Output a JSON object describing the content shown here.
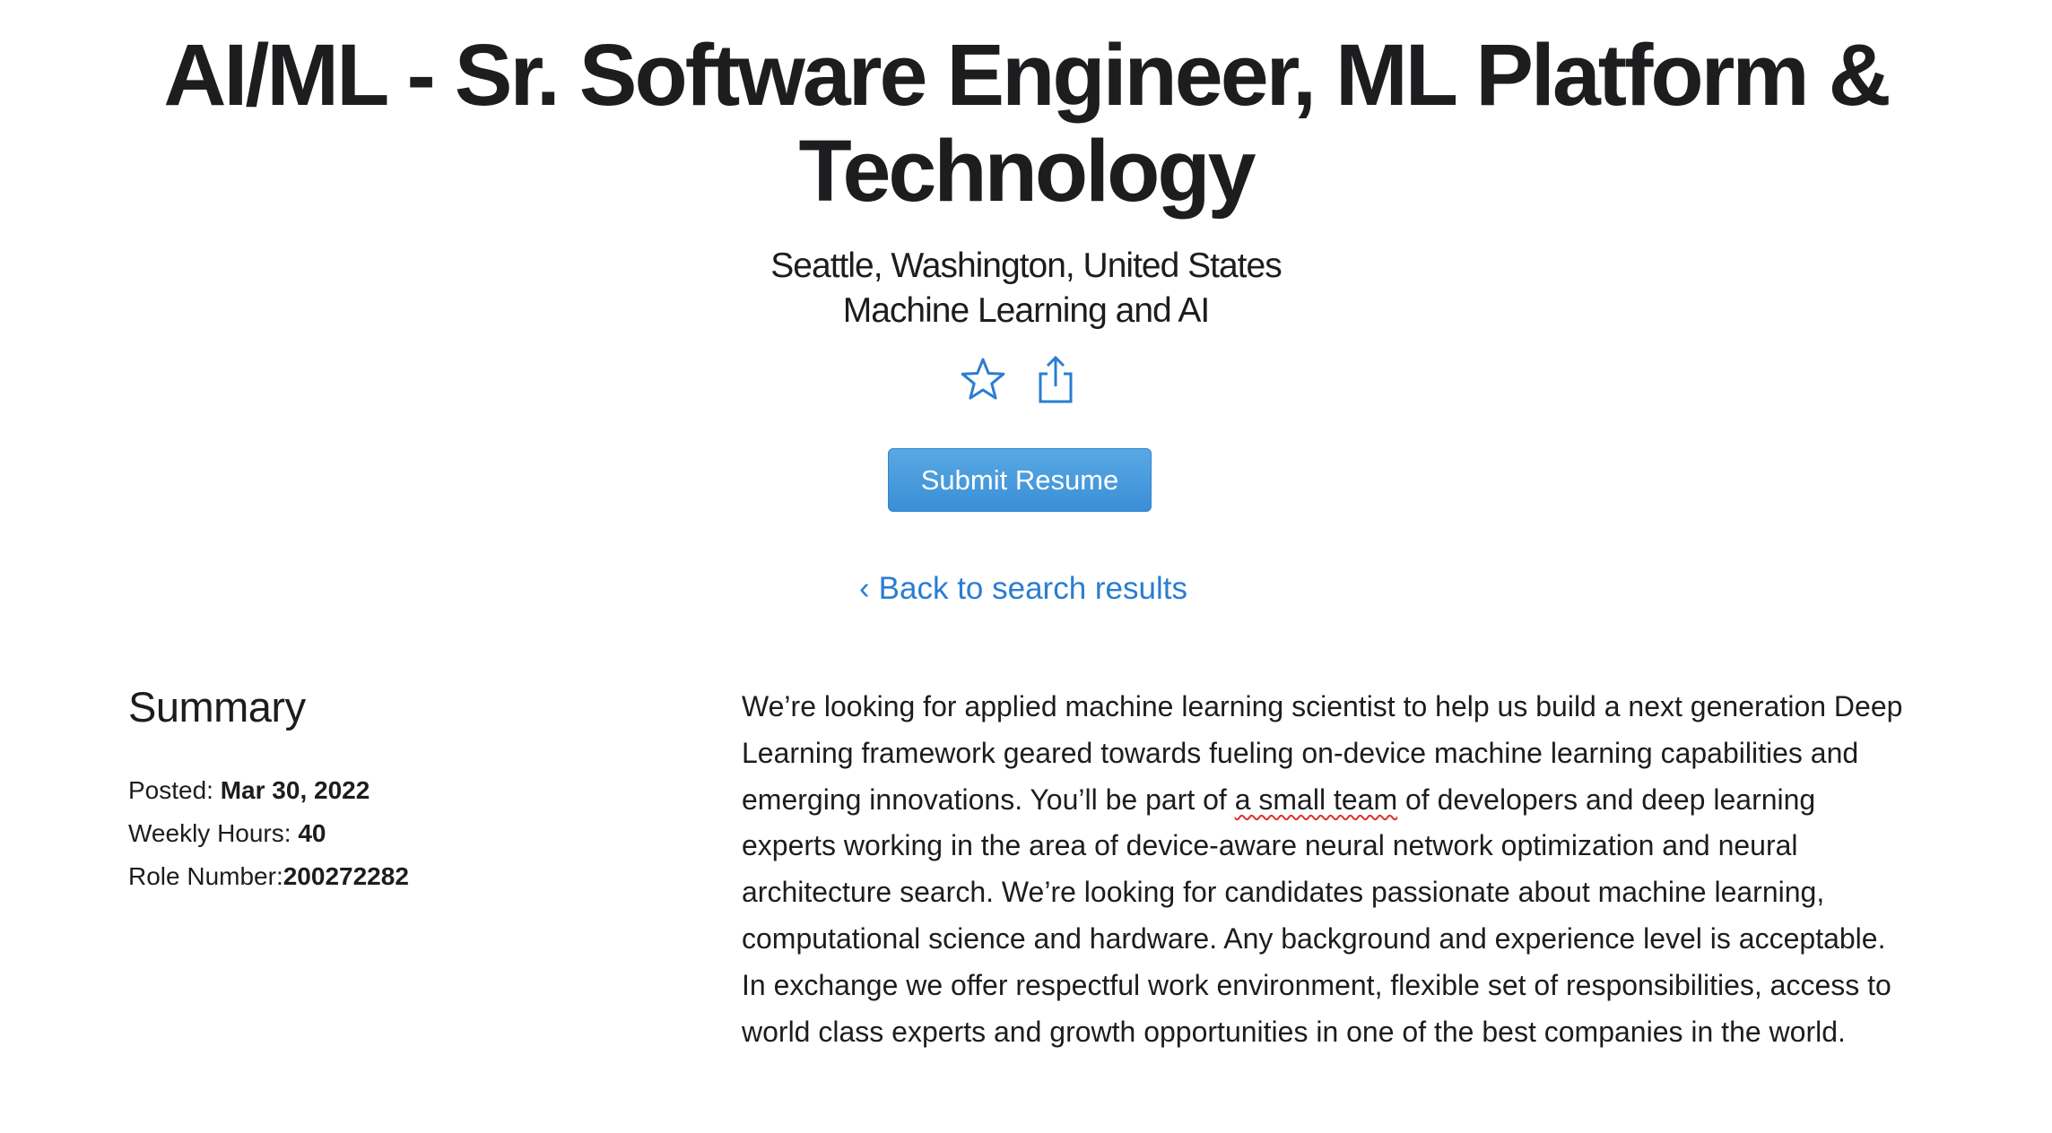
{
  "job": {
    "title": "AI/ML - Sr. Software Engineer, ML Platform & Technology",
    "location": "Seattle, Washington, United States",
    "team": "Machine Learning and AI"
  },
  "actions": {
    "favorite_icon": "star-outline-icon",
    "share_icon": "share-icon",
    "submit_label": "Submit Resume",
    "back_label": "Back to search results",
    "back_chevron": "‹"
  },
  "summary": {
    "heading": "Summary",
    "posted_label": "Posted:",
    "posted_value": "Mar 30, 2022",
    "hours_label": "Weekly Hours:",
    "hours_value": "40",
    "role_label": "Role Number:",
    "role_value": "200272282"
  },
  "description": {
    "before_flagged": "We’re looking for applied machine learning scientist to help us build a next generation Deep Learning framework geared towards fueling on-device machine learning capabilities and emerging innovations. You’ll be part of ",
    "flagged_text": "a small team",
    "after_flagged": " of developers and deep learning experts working in the area of device-aware neural network optimization and neural architecture search. We’re looking for candidates passionate about machine learning, computational science and hardware. Any background and experience level is acceptable. In exchange we offer respectful work environment, flexible set of responsibilities, access to world class experts and growth opportunities in one of the best companies in the world."
  },
  "colors": {
    "link": "#2a7dd1",
    "button": "#4a9cdf",
    "text": "#1d1d1f",
    "spellcheck_underline": "#e0302a"
  }
}
